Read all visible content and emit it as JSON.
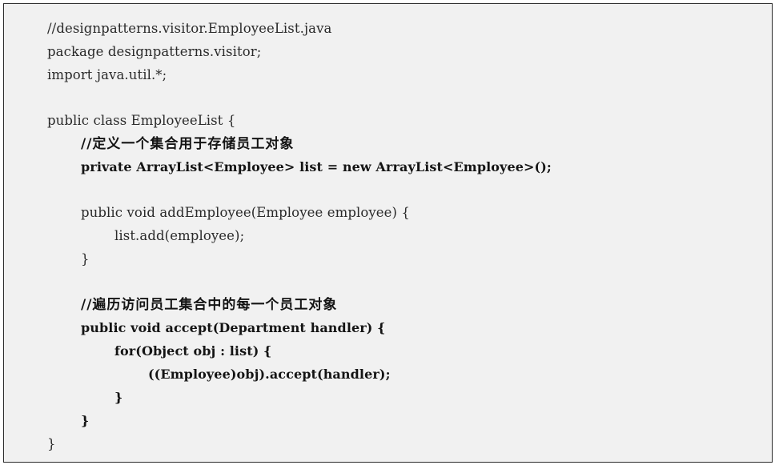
{
  "code": {
    "lines": [
      "//designpatterns.visitor.EmployeeList.java",
      "package designpatterns.visitor;",
      "import java.util.*;",
      "",
      "public class EmployeeList {",
      "//定义一个集合用于存储员工对象",
      "private ArrayList<Employee> list = new ArrayList<Employee>();",
      "",
      "public void addEmployee(Employee employee) {",
      "list.add(employee);",
      "}",
      "",
      "//遍历访问员工集合中的每一个员工对象",
      "public void accept(Department handler) {",
      "for(Object obj : list) {",
      "((Employee)obj).accept(handler);",
      "}",
      "}",
      "}"
    ]
  }
}
